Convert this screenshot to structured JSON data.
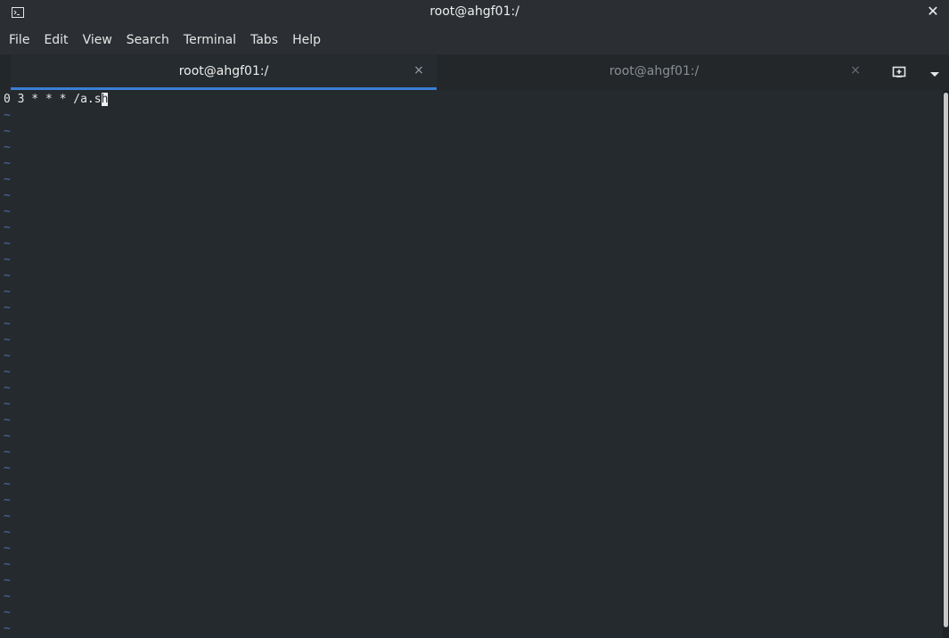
{
  "window": {
    "title": "root@ahgf01:/",
    "close_glyph": "✕"
  },
  "menu": {
    "items": [
      "File",
      "Edit",
      "View",
      "Search",
      "Terminal",
      "Tabs",
      "Help"
    ]
  },
  "tabs": [
    {
      "label": "root@ahgf01:/",
      "active": true,
      "close_glyph": "×"
    },
    {
      "label": "root@ahgf01:/",
      "active": false,
      "close_glyph": "×"
    }
  ],
  "tabbar": {
    "new_tab_icon": "new-tab-icon",
    "dropdown_icon": "chevron-down-icon"
  },
  "terminal": {
    "line_before_cursor": "0 3 * * * /a.s",
    "cursor_char": "h",
    "tilde_char": "~",
    "tilde_count": 33
  },
  "colors": {
    "background": "#252a2e",
    "tab_underline": "#3a7fd4",
    "tilde": "#4b6ea8"
  }
}
